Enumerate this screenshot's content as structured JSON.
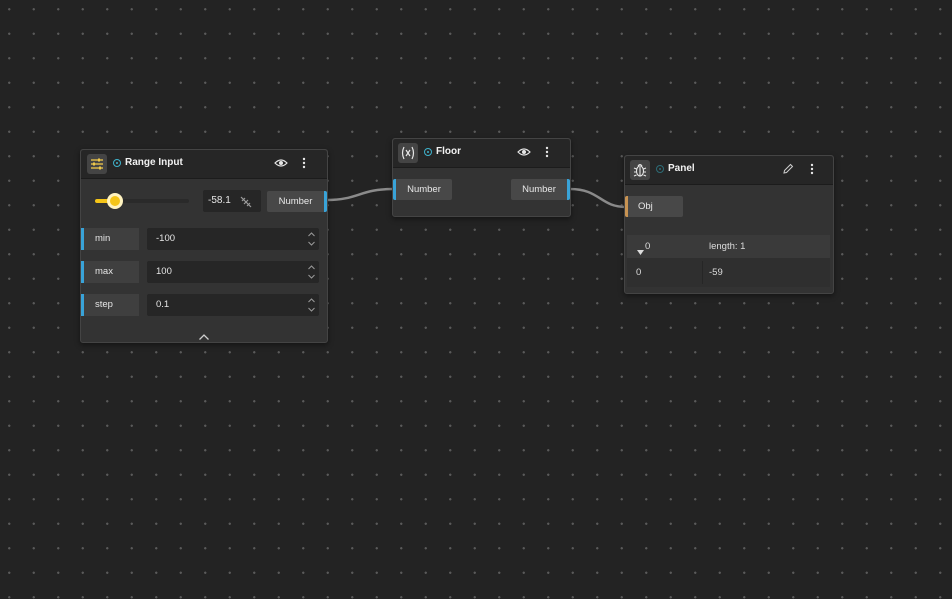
{
  "colors": {
    "accent_input": "#39a3d8",
    "accent_object": "#c89352",
    "slider": "#f5c518",
    "status": "#3fb3cc"
  },
  "range_node": {
    "title": "Range Input",
    "header_icon": "sliders-icon",
    "slider_value": "-58.1",
    "slider_fraction": 0.209,
    "output_label": "Number",
    "rows": [
      {
        "label": "min",
        "value": "-100"
      },
      {
        "label": "max",
        "value": "100"
      },
      {
        "label": "step",
        "value": "0.1"
      }
    ]
  },
  "floor_node": {
    "title": "Floor",
    "header_icon": "function-icon",
    "input_label": "Number",
    "output_label": "Number"
  },
  "panel_node": {
    "title": "Panel",
    "header_icon": "bug-icon",
    "input_label": "Obj",
    "table": {
      "header_key": "0",
      "header_value": "length: 1",
      "row_key": "0",
      "row_value": "-59"
    }
  }
}
